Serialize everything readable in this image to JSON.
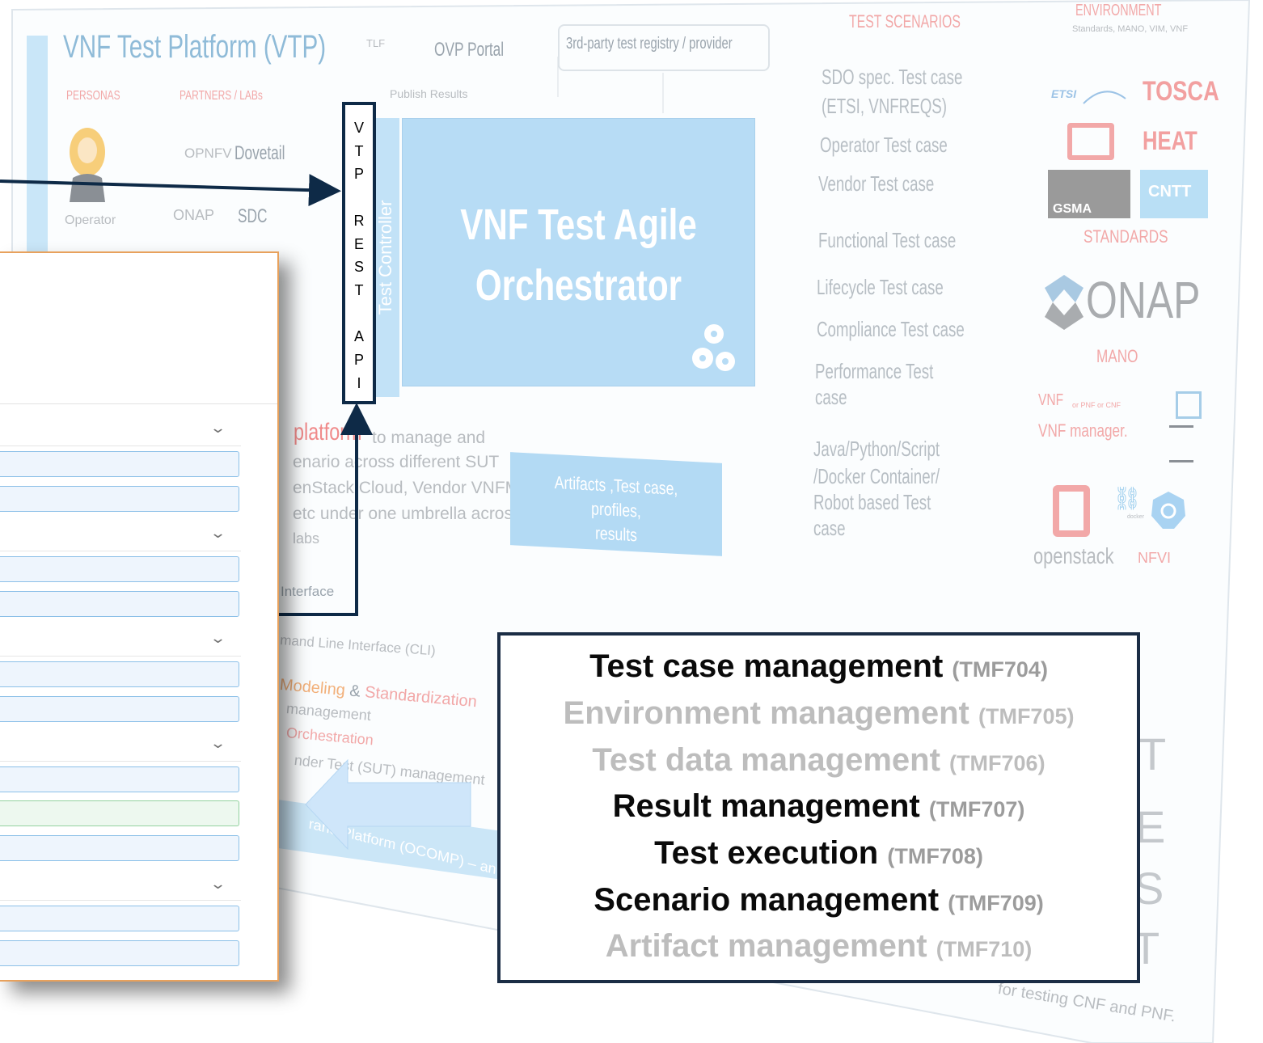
{
  "slide": {
    "title": "VNF Test Platform (VTP)",
    "tlf": "TLF",
    "ovp_portal": "OVP Portal",
    "third_party": "3rd-party test registry / provider",
    "publish_results": "Publish Results",
    "personas": "PERSONAS",
    "partners_labs": "PARTNERS / LABs",
    "opnfv": "OPNFV",
    "dovetail": "Dovetail",
    "onap_sdc_logo": "ONAP",
    "sdc": "SDC",
    "operator": "Operator",
    "test_controller": "Test Controller",
    "orchestrator_line1": "VNF Test Agile",
    "orchestrator_line2": "Orchestrator",
    "platform_word": "platform",
    "platform_text": [
      "to manage and",
      "enario across different SUT",
      "enStack Cloud, Vendor VNFM,",
      "etc under one umbrella across",
      "labs"
    ],
    "artifacts_line1": "Artifacts ,Test case, profiles,",
    "artifacts_line2": "results",
    "interface": "Interface",
    "cli": "mand Line Interface (CLI)",
    "modeling_dark": "Modeling",
    "modeling_amp": "&",
    "modeling_red": "Standardization",
    "management": "management",
    "orchestration": "Orchestration",
    "sut": "nder Test (SUT) management",
    "footer_band": "rand Platform (OCOMP) – an onl",
    "tests_letters": [
      "T",
      "E",
      "S",
      "T"
    ],
    "bottom_right": "for testing CNF and PNF.",
    "test_scenarios_header": "TEST SCENARIOS",
    "environment_header": "ENVIRONMENT",
    "env_sub": "Standards, MANO, VIM, VNF",
    "scenarios": [
      "SDO spec. Test case",
      "(ETSI, VNFREQS)",
      "Operator Test case",
      "Vendor  Test case",
      "Functional Test case",
      "Lifecycle Test case",
      "Compliance Test case",
      "Performance Test",
      "case",
      "Java/Python/Script",
      "/Docker Container/",
      "Robot based Test",
      "case"
    ],
    "etsi": "ETSI",
    "tosca": "TOSCA",
    "heat": "HEAT",
    "gsma": "GSMA",
    "cntt": "CNTT",
    "standards": "STANDARDS",
    "onap": "ONAP",
    "mano": "MANO",
    "vnf": "VNF",
    "vnf_small": "or PNF or CNF",
    "vnf_manager": "VNF manager.",
    "openstack": "openstack",
    "nfvi": "NFVI",
    "docker": "docker"
  },
  "vtp_rest_api": [
    "V",
    "T",
    "P",
    "",
    "R",
    "E",
    "S",
    "T",
    "",
    "A",
    "P",
    "I"
  ],
  "tmf_list": [
    {
      "name": "Test case management",
      "code": "(TMF704)",
      "style": "dark"
    },
    {
      "name": "Environment  management",
      "code": "(TMF705)",
      "style": "light"
    },
    {
      "name": "Test data management",
      "code": "(TMF706)",
      "style": "light"
    },
    {
      "name": "Result management",
      "code": "(TMF707)",
      "style": "dark"
    },
    {
      "name": "Test execution",
      "code": "(TMF708)",
      "style": "dark"
    },
    {
      "name": "Scenario management",
      "code": "(TMF709)",
      "style": "dark"
    },
    {
      "name": "Artifact management",
      "code": "(TMF710)",
      "style": "light"
    }
  ],
  "panel": {
    "chevron": "⌄"
  },
  "colors": {
    "navy": "#0e2a47",
    "panel_border": "#e8a15c",
    "field_blue": "#8cc0e8",
    "field_green": "#93d19f",
    "arrow_blue": "#cfe6fa"
  }
}
